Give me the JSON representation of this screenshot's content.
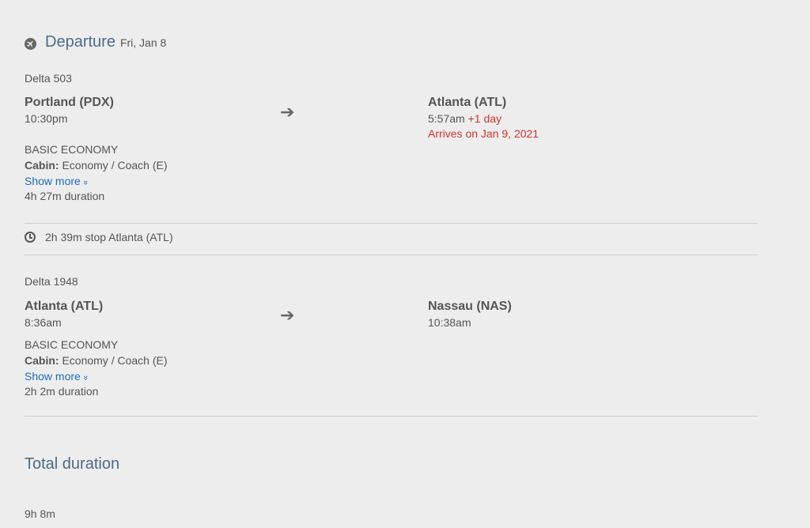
{
  "departure": {
    "title": "Departure",
    "date": "Fri, Jan 8"
  },
  "segments": [
    {
      "flight": "Delta 503",
      "from_city": "Portland (PDX)",
      "from_time": "10:30pm",
      "to_city": "Atlanta (ATL)",
      "to_time": "5:57am",
      "to_day_offset": "+1 day",
      "arrives_note": "Arrives on Jan 9, 2021",
      "fare_class": "BASIC ECONOMY",
      "cabin_label": "Cabin:",
      "cabin_value": "Economy / Coach (E)",
      "show_more": "Show more",
      "duration": "4h 27m duration"
    },
    {
      "flight": "Delta 1948",
      "from_city": "Atlanta (ATL)",
      "from_time": "8:36am",
      "to_city": "Nassau (NAS)",
      "to_time": "10:38am",
      "fare_class": "BASIC ECONOMY",
      "cabin_label": "Cabin:",
      "cabin_value": "Economy / Coach (E)",
      "show_more": "Show more",
      "duration": "2h 2m duration"
    }
  ],
  "stop": {
    "text": "2h 39m stop Atlanta (ATL)"
  },
  "total": {
    "title": "Total duration",
    "value": "9h 8m"
  },
  "icons": {
    "departure": "airplane-icon",
    "stop": "clock-icon",
    "arrow": "right-arrow-icon",
    "expand": "double-chevron-down-icon"
  },
  "colors": {
    "accent_title": "#4d6a8a",
    "link": "#1e6bb8",
    "alert": "#d0342c",
    "background": "#ededed"
  }
}
